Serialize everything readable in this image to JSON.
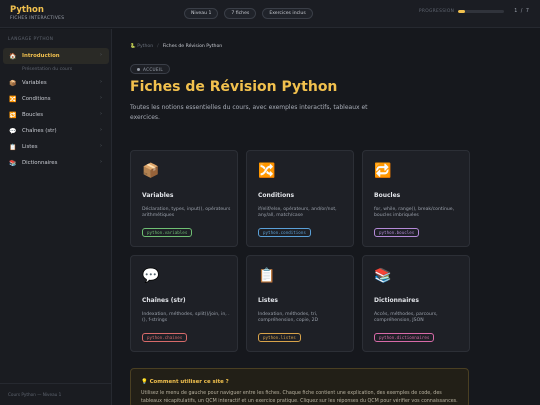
{
  "header": {
    "title": "Python",
    "subtitle": "FICHES INTERACTIVES",
    "pills": [
      "Niveau 1",
      "7 fiches",
      "Exercices inclus"
    ],
    "progress_label": "PROGRESSION",
    "progress_value": 0.14,
    "progress_count": "1 / 7",
    "accent": "#f2c14e"
  },
  "sidebar": {
    "heading": "LANGAGE PYTHON",
    "items": [
      {
        "icon": "🏠",
        "icon_name": "home-icon",
        "label": "Introduction",
        "active": true
      },
      {
        "icon": "📦",
        "icon_name": "package-icon",
        "label": "Variables"
      },
      {
        "icon": "🔀",
        "icon_name": "shuffle-icon",
        "label": "Conditions"
      },
      {
        "icon": "🔁",
        "icon_name": "repeat-icon",
        "label": "Boucles"
      },
      {
        "icon": "💬",
        "icon_name": "speech-bubble-icon",
        "label": "Chaînes (str)"
      },
      {
        "icon": "📋",
        "icon_name": "clipboard-icon",
        "label": "Listes"
      },
      {
        "icon": "📚",
        "icon_name": "books-icon",
        "label": "Dictionnaires"
      }
    ],
    "sub_item": "Présentation du cours",
    "footer": "Cours Python — Niveau 1"
  },
  "main": {
    "breadcrumb": {
      "home": "Python",
      "separator": "/",
      "current": "Fiches de Révision Python"
    },
    "badge": "ACCUEIL",
    "title": "Fiches de Révision Python",
    "description": "Toutes les notions essentielles du cours, avec exemples interactifs, tableaux et exercices.",
    "cards": [
      {
        "icon": "📦",
        "icon_name": "package-icon",
        "title": "Variables",
        "desc": "Déclaration, types, input(), opérateurs arithmétiques",
        "tag": "python.variables",
        "tag_color": "#6fbf73"
      },
      {
        "icon": "🔀",
        "icon_name": "shuffle-icon",
        "title": "Conditions",
        "desc": "if/elif/else, opérateurs, and/or/not, any/all, match/case",
        "tag": "python.conditions",
        "tag_color": "#5aa0d8"
      },
      {
        "icon": "🔁",
        "icon_name": "repeat-icon",
        "title": "Boucles",
        "desc": "for, while, range(), break/continue, boucles imbriquées",
        "tag": "python.boucles",
        "tag_color": "#b48ad8"
      },
      {
        "icon": "💬",
        "icon_name": "speech-bubble-icon",
        "title": "Chaînes (str)",
        "desc": "Indexation, méthodes, split()/join, in, .(), f-strings",
        "tag": "python.chaines",
        "tag_color": "#d86a6a"
      },
      {
        "icon": "📋",
        "icon_name": "clipboard-icon",
        "title": "Listes",
        "desc": "Indexation, méthodes, tri, compréhension, copie, 2D",
        "tag": "python.listes",
        "tag_color": "#d8a34a"
      },
      {
        "icon": "📚",
        "icon_name": "books-icon",
        "title": "Dictionnaires",
        "desc": "Accès, méthodes, parcours, compréhension, JSON",
        "tag": "python.dictionnaires",
        "tag_color": "#d86aa8"
      }
    ],
    "tip": {
      "title": "💡 Comment utiliser ce site ?",
      "text": "Utilisez le menu de gauche pour naviguer entre les fiches. Chaque fiche contient une explication, des exemples de code, des tableaux récapitulatifs, un QCM interactif et un exercice pratique. Cliquez sur les réponses du QCM pour vérifier vos connaissances."
    }
  }
}
